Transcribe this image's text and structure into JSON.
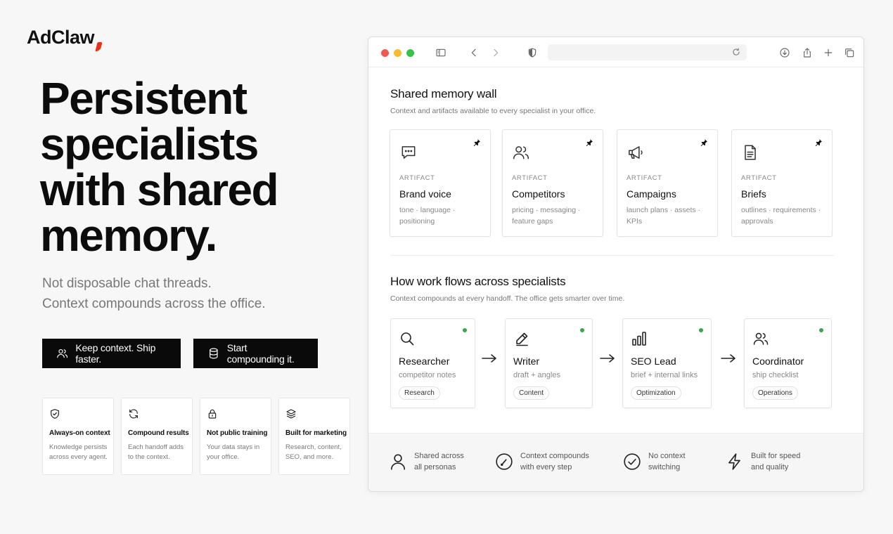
{
  "brand": {
    "name": "AdClaw",
    "accent": "#e5331a"
  },
  "hero": {
    "headline": [
      "Persistent",
      "specialists",
      "with shared",
      "memory."
    ],
    "subtitle": [
      "Not disposable chat threads.",
      "Context compounds across the office."
    ]
  },
  "cta": [
    {
      "label": "Keep context. Ship faster.",
      "icon": "users-icon"
    },
    {
      "label": "Start compounding it.",
      "icon": "database-icon"
    }
  ],
  "features": [
    {
      "title": "Always-on context",
      "desc": "Knowledge persists across every agent.",
      "icon": "shield-check-icon"
    },
    {
      "title": "Compound results",
      "desc": "Each handoff adds to the context.",
      "icon": "refresh-icon"
    },
    {
      "title": "Not public training",
      "desc": "Your data stays in your office.",
      "icon": "lock-icon"
    },
    {
      "title": "Built for marketing",
      "desc": "Research, content, SEO, and more.",
      "icon": "layers-icon"
    }
  ],
  "browser": {
    "memory": {
      "title": "Shared memory wall",
      "subtitle": "Context and artifacts available to every specialist in your office.",
      "artifacts": [
        {
          "label": "ARTIFACT",
          "title": "Brand voice",
          "desc": "tone · language · positioning",
          "icon": "chat-icon"
        },
        {
          "label": "ARTIFACT",
          "title": "Competitors",
          "desc": "pricing · messaging · feature gaps",
          "icon": "users-icon"
        },
        {
          "label": "ARTIFACT",
          "title": "Campaigns",
          "desc": "launch plans · assets · KPIs",
          "icon": "megaphone-icon"
        },
        {
          "label": "ARTIFACT",
          "title": "Briefs",
          "desc": "outlines · requirements · approvals",
          "icon": "document-icon"
        }
      ]
    },
    "flow": {
      "title": "How work flows across specialists",
      "subtitle": "Context compounds at every handoff. The office gets smarter over time.",
      "steps": [
        {
          "title": "Researcher",
          "desc": "competitor notes",
          "tag": "Research",
          "icon": "search-icon"
        },
        {
          "title": "Writer",
          "desc": "draft + angles",
          "tag": "Content",
          "icon": "pen-icon"
        },
        {
          "title": "SEO Lead",
          "desc": "brief + internal links",
          "tag": "Optimization",
          "icon": "bar-chart-icon"
        },
        {
          "title": "Coordinator",
          "desc": "ship checklist",
          "tag": "Operations",
          "icon": "users-icon"
        }
      ],
      "status_color": "#3aa64a"
    },
    "footer": [
      {
        "lines": [
          "Shared across",
          "all personas"
        ],
        "icon": "user-icon"
      },
      {
        "lines": [
          "Context compounds",
          "with every step"
        ],
        "icon": "gauge-icon"
      },
      {
        "lines": [
          "No context",
          "switching"
        ],
        "icon": "check-circle-icon"
      },
      {
        "lines": [
          "Built for speed",
          "and quality"
        ],
        "icon": "lightning-icon"
      }
    ]
  }
}
